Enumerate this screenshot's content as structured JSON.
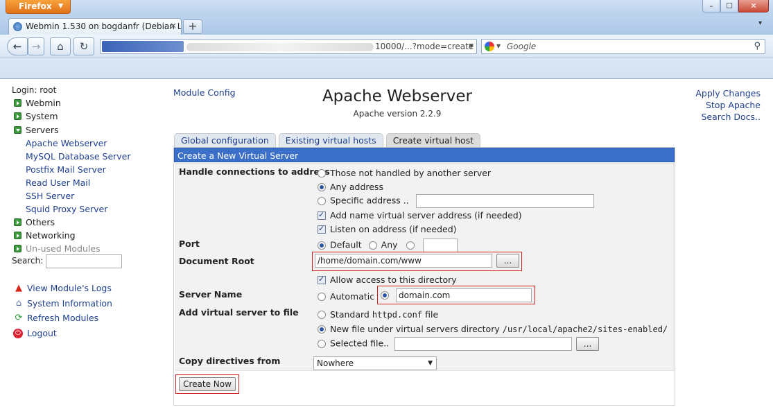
{
  "browser": {
    "firefox_label": "Firefox",
    "tab_title": "Webmin 1.530 on bogdanfr (Debian Li...",
    "tab_close": "×",
    "newtab_label": "+",
    "tablist_label": "▾",
    "url_tail": "10000/...?mode=create",
    "search_placeholder": "Google",
    "win_min": "–",
    "win_max": "☐",
    "win_close": "✕"
  },
  "left": {
    "login_label": "Login: root",
    "categories": [
      {
        "label": "Webmin"
      },
      {
        "label": "System"
      },
      {
        "label": "Servers"
      }
    ],
    "server_modules": [
      "Apache Webserver",
      "MySQL Database Server",
      "Postfix Mail Server",
      "Read User Mail",
      "SSH Server",
      "Squid Proxy Server"
    ],
    "more_categories": [
      {
        "label": "Others"
      },
      {
        "label": "Networking"
      },
      {
        "label": "Un-used Modules"
      }
    ],
    "search_label": "Search:",
    "actions": {
      "logs": "View Module's Logs",
      "sysinfo": "System Information",
      "refresh": "Refresh Modules",
      "logout": "Logout"
    }
  },
  "main": {
    "module_config": "Module Config",
    "title": "Apache Webserver",
    "subtitle": "Apache version 2.2.9",
    "right_links": {
      "apply": "Apply Changes",
      "stop": "Stop Apache",
      "docs": "Search Docs.."
    },
    "tabs": {
      "global": "Global configuration",
      "existing": "Existing virtual hosts",
      "create": "Create virtual host"
    },
    "panel_title": "Create a New Virtual Server",
    "form": {
      "address_label": "Handle connections to address",
      "addr_not_handled": "Those not handled by another server",
      "addr_any": "Any address",
      "addr_specific": "Specific address ..",
      "add_name_vs": "Add name virtual server address (if needed)",
      "listen_on": "Listen on address (if needed)",
      "port_label": "Port",
      "port_default": "Default",
      "port_any": "Any",
      "docroot_label": "Document Root",
      "docroot_value": "/home/domain.com/www",
      "browse": "...",
      "allow_access": "Allow access to this directory",
      "servername_label": "Server Name",
      "servername_auto": "Automatic",
      "servername_value": "domain.com",
      "addfile_label": "Add virtual server to file",
      "standard_prefix": "Standard",
      "standard_code": "httpd.conf",
      "standard_suffix": "file",
      "newfile_prefix": "New file under virtual servers directory",
      "newfile_code": "/usr/local/apache2/sites-enabled/",
      "selected_file": "Selected file..",
      "copy_label": "Copy directives from",
      "copy_value": "Nowhere"
    },
    "submit": "Create Now"
  }
}
